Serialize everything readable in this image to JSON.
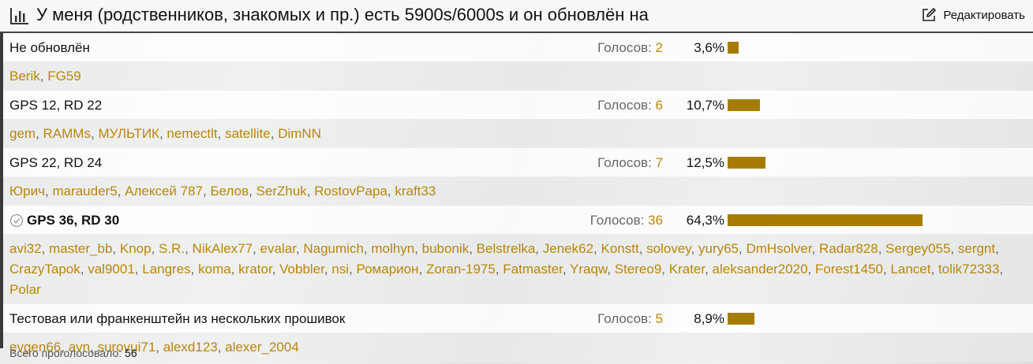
{
  "poll": {
    "title": "У меня (родственников, знакомых и пр.) есть 5900s/6000s и он обновлён на",
    "edit_label": "Редактировать",
    "votes_prefix": "Голосов:",
    "total_label": "Всего проголосовало:",
    "total_value": "56",
    "accent_color": "#b8860b",
    "bar_color": "#a67c00",
    "options": [
      {
        "label": "Не обновлён",
        "votes": "2",
        "percent": "3,6%",
        "fraction": 0.036,
        "chosen": false,
        "voters": [
          "Berik",
          "FG59"
        ]
      },
      {
        "label": "GPS 12, RD 22",
        "votes": "6",
        "percent": "10,7%",
        "fraction": 0.107,
        "chosen": false,
        "voters": [
          "gem",
          "RAMMs",
          "МУЛЬТИК",
          "nemectlt",
          "satellite",
          "DimNN"
        ]
      },
      {
        "label": "GPS 22, RD 24",
        "votes": "7",
        "percent": "12,5%",
        "fraction": 0.125,
        "chosen": false,
        "voters": [
          "Юрич",
          "marauder5",
          "Алексей 787",
          "Белов",
          "SerZhuk",
          "RostovPapa",
          "kraft33"
        ]
      },
      {
        "label": "GPS 36, RD 30",
        "votes": "36",
        "percent": "64,3%",
        "fraction": 0.643,
        "chosen": true,
        "voters": [
          "avi32",
          "master_bb",
          "Knop",
          "S.R.",
          "NikAlex77",
          "evalar",
          "Nagumich",
          "molhyn",
          "bubonik",
          "Belstrelka",
          "Jenek62",
          "Konstt",
          "solovey",
          "yury65",
          "DmHsolver",
          "Radar828",
          "Sergey055",
          "sergnt",
          "CrazyTapok",
          "val9001",
          "Langres",
          "koma",
          "krator",
          "Vobbler",
          "nsi",
          "Ромарион",
          "Zoran-1975",
          "Fatmaster",
          "Yraqw",
          "Stereo9",
          "Krater",
          "aleksander2020",
          "Forest1450",
          "Lancet",
          "tolik72333",
          "Polar"
        ]
      },
      {
        "label": "Тестовая или франкенштейн из нескольких прошивок",
        "votes": "5",
        "percent": "8,9%",
        "fraction": 0.089,
        "chosen": false,
        "voters": [
          "evgen66",
          "avn",
          "surovui71",
          "alexd123",
          "alexer_2004"
        ]
      }
    ]
  }
}
